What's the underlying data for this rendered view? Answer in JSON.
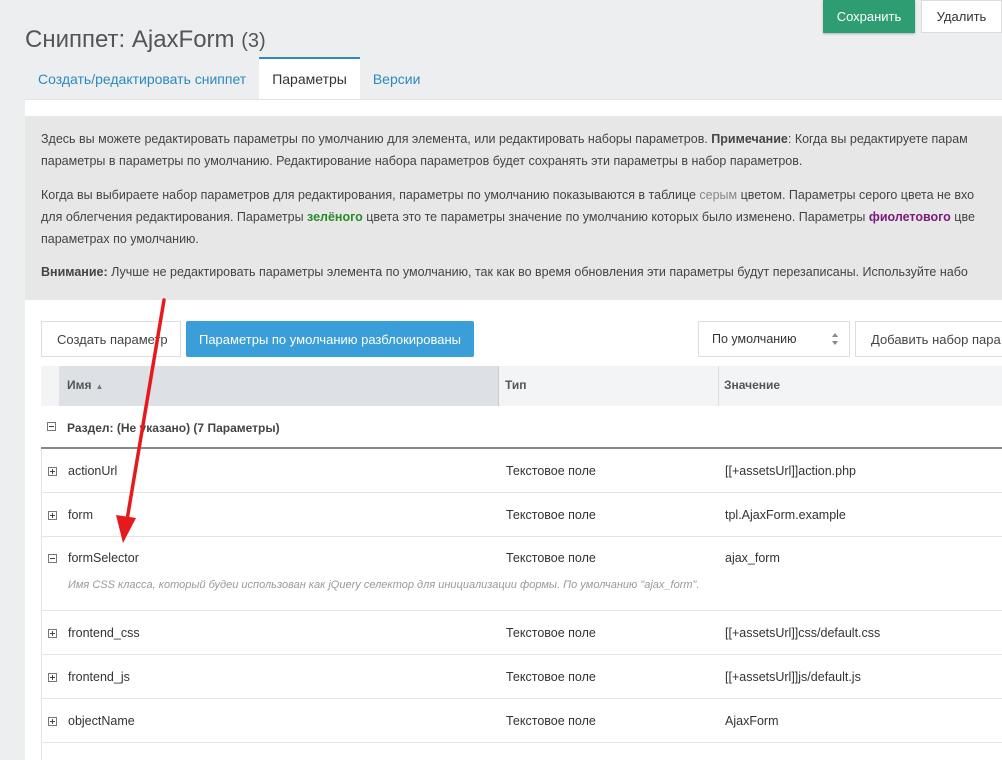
{
  "page": {
    "title": "Сниппет: AjaxForm",
    "count": "(3)"
  },
  "actions": {
    "save_label": "Сохранить",
    "delete_label": "Удалить"
  },
  "tabs": [
    {
      "label": "Создать/редактировать сниппет",
      "active": false
    },
    {
      "label": "Параметры",
      "active": true
    },
    {
      "label": "Версии",
      "active": false
    }
  ],
  "description": {
    "p1_text": "Здесь вы можете редактировать параметры по умолчанию для элемента, или редактировать наборы параметров. ",
    "p1_note_label": "Примечание",
    "p1_note_text": ": Когда вы редактируете парам",
    "p1_line2": "параметры в параметры по умолчанию. Редактирование набора параметров будет сохранять эти параметры в набор параметров.",
    "p2_a": "Когда вы выбираете набор параметров для редактирования, параметры по умолчанию показываются в таблице ",
    "p2_grey": "серым",
    "p2_b": " цветом. Параметры серого цвета не вхо",
    "p2_c": "для облегчения редактирования. Параметры ",
    "p2_green": "зелёного",
    "p2_d": " цвета это те параметры значение по умолчанию которых было изменено. Параметры ",
    "p2_purple": "фиолетового",
    "p2_e": " цве",
    "p2_f": "параметрах по умолчанию.",
    "p3_warn_label": "Внимание:",
    "p3_text": " Лучше не редактировать параметры элемента по умолчанию, так как во время обновления эти параметры будут перезаписаны. Используйте набо"
  },
  "toolbar": {
    "create_param_label": "Создать параметр",
    "unlock_label": "Параметры по умолчанию разблокированы",
    "set_select_value": "По умолчанию",
    "add_set_label": "Добавить набор пара"
  },
  "grid": {
    "columns": [
      "Имя",
      "Тип",
      "Значение"
    ],
    "section_label": "Раздел: (Не указано) (7 Параметры)",
    "rows": [
      {
        "name": "actionUrl",
        "type": "Текстовое поле",
        "value": "[[+assetsUrl]]action.php"
      },
      {
        "name": "form",
        "type": "Текстовое поле",
        "value": "tpl.AjaxForm.example"
      },
      {
        "name": "formSelector",
        "type": "Текстовое поле",
        "value": "ajax_form",
        "description": "Имя CSS класса, который будеи использован как jQuery селектор для инициализации формы. По умолчанию \"ajax_form\"."
      },
      {
        "name": "frontend_css",
        "type": "Текстовое поле",
        "value": "[[+assetsUrl]]css/default.css"
      },
      {
        "name": "frontend_js",
        "type": "Текстовое поле",
        "value": "[[+assetsUrl]]js/default.js"
      },
      {
        "name": "objectName",
        "type": "Текстовое поле",
        "value": "AjaxForm"
      }
    ]
  },
  "colors": {
    "accent": "#2b8ac0",
    "save": "#2e9d72",
    "unlock": "#3a9ed9",
    "arrow": "#e8191c"
  }
}
